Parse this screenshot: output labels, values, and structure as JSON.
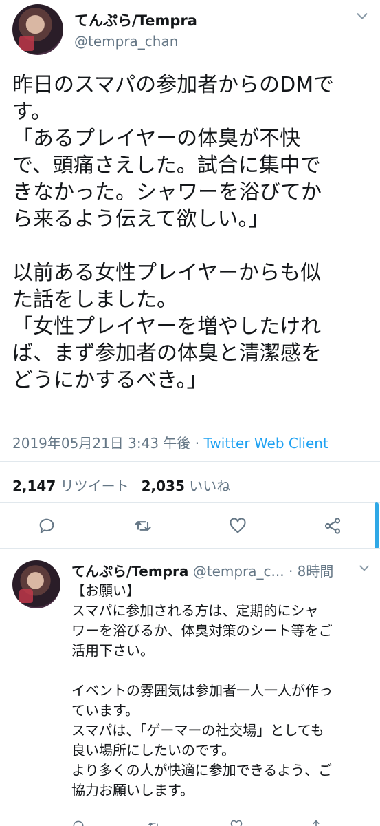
{
  "main_tweet": {
    "display_name": "てんぷら/Tempra",
    "handle": "@tempra_chan",
    "lines": [
      "昨日のスマパの参加者からのDMで",
      "す。",
      "「あるプレイヤーの体臭が不快",
      "で、頭痛さえした。試合に集中で",
      "きなかった。シャワーを浴びてか",
      "ら来るよう伝えて欲しい。」",
      "",
      "以前ある女性プレイヤーからも似",
      "た話をしました。",
      "「女性プレイヤーを増やしたけれ",
      "ば、まず参加者の体臭と清潔感を",
      "どうにかするべき。」"
    ],
    "timestamp": "2019年05月21日 3:43 午後",
    "separator": " · ",
    "client": "Twitter Web Client",
    "retweets_count": "2,147",
    "retweets_label": "リツイート",
    "likes_count": "2,035",
    "likes_label": "いいね"
  },
  "reply_tweet": {
    "display_name": "てんぷら/Tempra",
    "handle": "@tempra_c...",
    "time": "· 8時間",
    "lines": [
      "【お願い】",
      "スマパに参加される方は、定期的にシャ",
      "ワーを浴びるか、体臭対策のシート等をご",
      "活用下さい。",
      "",
      "イベントの雰囲気は参加者一人一人が作っ",
      "ています。",
      "スマパは、「ゲーマーの社交場」としても",
      "良い場所にしたいのです。",
      "より多くの人が快適に参加できるよう、ご",
      "協力お願いします。"
    ]
  },
  "icons": {
    "reply": "reply-icon",
    "retweet": "retweet-icon",
    "like": "heart-icon",
    "share": "share-icon",
    "more": "chevron-down-icon"
  },
  "colors": {
    "accent": "#1da1f2",
    "secondary_text": "#657786",
    "text": "#14171a"
  }
}
